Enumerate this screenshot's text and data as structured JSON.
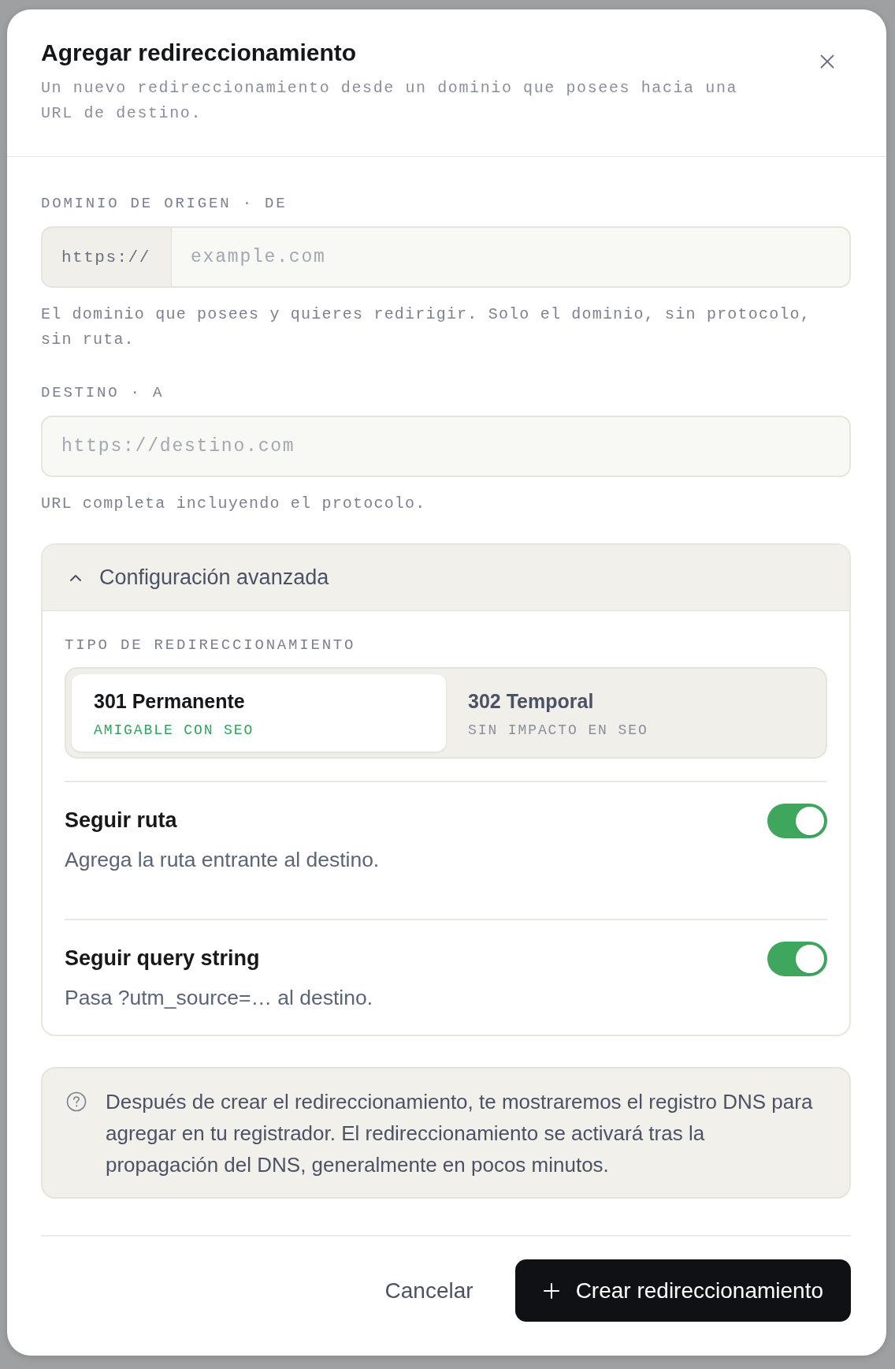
{
  "dialog": {
    "title": "Agregar redireccionamiento",
    "description": "Un nuevo redireccionamiento desde un dominio que posees hacia una URL de destino."
  },
  "fields": [
    {
      "label": "DOMINIO DE ORIGEN · DE",
      "prefix": "https://",
      "placeholder": "example.com",
      "help": "El dominio que posees y quieres redirigir. Solo el dominio, sin protocolo, sin ruta."
    },
    {
      "label": "DESTINO · A",
      "placeholder": "https://destino.com",
      "help": "URL completa incluyendo el protocolo."
    }
  ],
  "advanced": {
    "title": "Configuración avanzada",
    "expanded": true,
    "type_label": "TIPO DE REDIRECCIONAMIENTO",
    "options": [
      {
        "title": "301 Permanente",
        "subtitle": "AMIGABLE CON SEO",
        "selected": true
      },
      {
        "title": "302 Temporal",
        "subtitle": "SIN IMPACTO EN SEO",
        "selected": false
      }
    ],
    "toggles": [
      {
        "label": "Seguir ruta",
        "description": "Agrega la ruta entrante al destino.",
        "on": true
      },
      {
        "label": "Seguir query string",
        "description": "Pasa ?utm_source=… al destino.",
        "on": true
      }
    ]
  },
  "info": {
    "text": "Después de crear el redireccionamiento, te mostraremos el registro DNS para agregar en tu registrador. El redireccionamiento se activará tras la propagación del DNS, generalmente en pocos minutos."
  },
  "buttons": [
    {
      "kind": "secondary",
      "label": "Cancelar"
    },
    {
      "kind": "primary",
      "label": "Crear redireccionamiento"
    }
  ]
}
